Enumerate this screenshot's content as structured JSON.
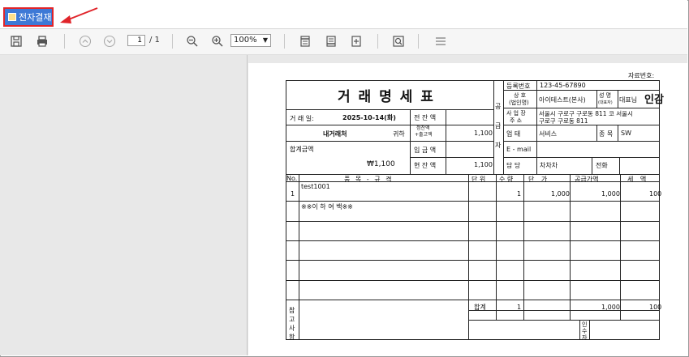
{
  "top": {
    "pay_label": "전자결재"
  },
  "toolbar": {
    "page_current": "1",
    "page_total": "/ 1",
    "zoom": "100%"
  },
  "doc": {
    "ref_label": "자료번호:",
    "title": "거 래 명 세 표",
    "date_label": "거 래 일:",
    "date_value": "2025-10-14(화)",
    "client": "내거래처",
    "client_suffix": "귀하",
    "prev_balance_label": "전 잔 액",
    "total_label_top": "정잔액",
    "total_label_bot": "+출고액",
    "total_value": "1,100",
    "sum_label": "합계금액",
    "sum_value": "₩1,100",
    "deposit_label": "입 금 액",
    "balance_label": "현 잔 액",
    "balance_value": "1,100",
    "supplier_vlabel": [
      "공",
      "급",
      "자"
    ],
    "reg_no_label": "등록번호",
    "reg_no": "123-45-67890",
    "company_label_top": "상 호",
    "company_label_bot": "(법인명)",
    "company": "아이테스트(본사)",
    "name_label_top": "성 명",
    "name_label_bot": "(대표자)",
    "rep": "대표님",
    "seal": "인감",
    "addr_label_top": "사 업 장",
    "addr_label_bot": "주 소",
    "addr_line1": "서울시 구로구 구로동 811 코 서울시",
    "addr_line2": "구로구 구로동 811",
    "biz_label": "업 태",
    "biz": "서비스",
    "item_type_label": "종 목",
    "item_type": "SW",
    "email_label": "E - mail",
    "manager_label": "담 당",
    "manager": "차차차",
    "phone_label": "전화",
    "columns": {
      "no": "No.",
      "item": "품 목 - 규 격",
      "unit": "단 위",
      "qty": "수 량",
      "price": "단 가",
      "supply": "공급가액",
      "tax": "세 액"
    },
    "rows": [
      {
        "no": "1",
        "item": "test1001",
        "qty": "1",
        "price": "1,000",
        "supply": "1,000",
        "tax": "100"
      }
    ],
    "blank_note": "※※이 하 여 백※※",
    "remarks_vlabel": [
      "참",
      "고",
      "사",
      "항"
    ],
    "total_row_label": "합계",
    "total_qty": "1",
    "total_supply": "1,000",
    "total_tax": "100",
    "receiver_vlabel": [
      "인",
      "수",
      "자"
    ]
  }
}
